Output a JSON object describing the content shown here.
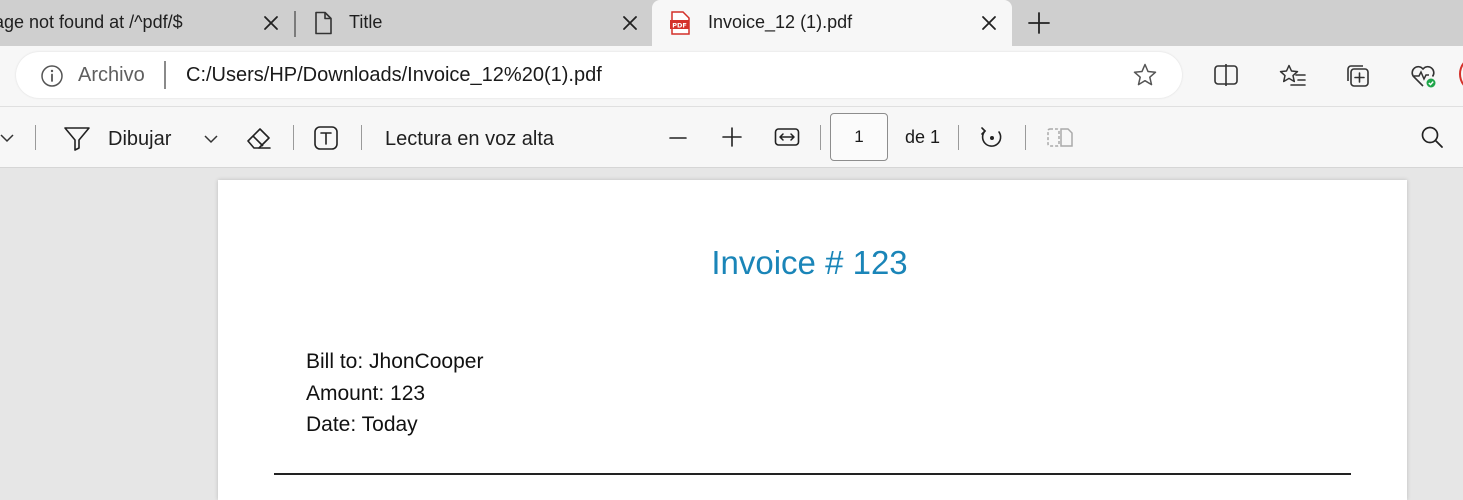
{
  "tabs": [
    {
      "title": "age not found at /^pdf/$",
      "icon": "none",
      "active": false
    },
    {
      "title": "Title",
      "icon": "document-icon",
      "active": false
    },
    {
      "title": "Invoice_12 (1).pdf",
      "icon": "pdf-icon",
      "active": true
    }
  ],
  "address_bar": {
    "site_label": "Archivo",
    "url": "C:/Users/HP/Downloads/Invoice_12%20(1).pdf"
  },
  "pdf_toolbar": {
    "draw_label": "Dibujar",
    "read_aloud_label": "Lectura en voz alta",
    "page_number": "1",
    "page_total": "de 1"
  },
  "document": {
    "title": "Invoice # 123",
    "lines": [
      "Bill to: JhonCooper",
      "Amount: 123",
      "Date: Today"
    ]
  },
  "colors": {
    "title_blue": "#1a85b8",
    "pdf_red": "#d4312a",
    "heart_green": "#1fa64a"
  }
}
